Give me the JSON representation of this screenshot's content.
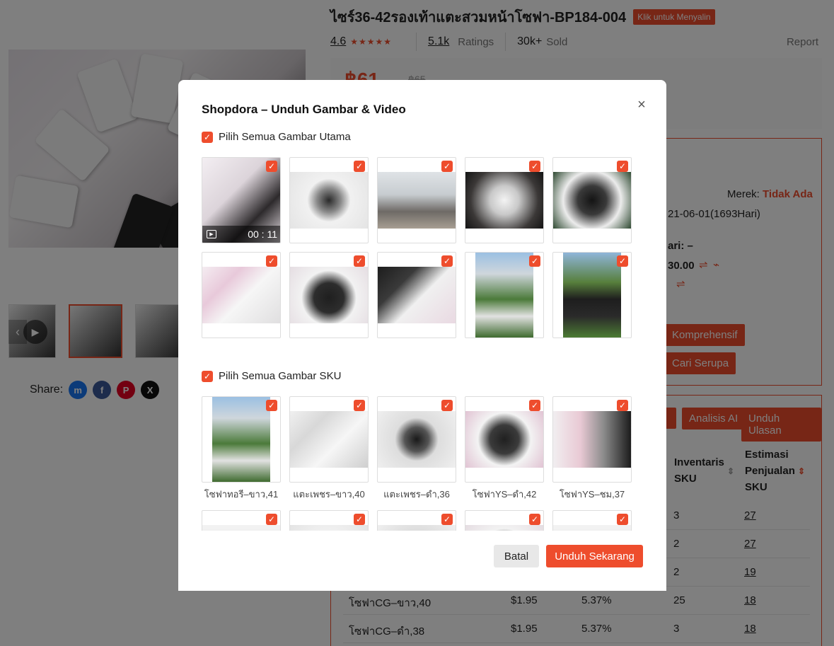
{
  "page": {
    "product_title": "ไซร์36-42รองเท้าแตะสวมหน้าโซฟา-BP184-004",
    "copy_badge": "Klik untuk Menyalin",
    "rating": "4.6",
    "ratings_count": "5.1k",
    "ratings_label": "Ratings",
    "sold_count": "30k+",
    "sold_label": "Sold",
    "report": "Report",
    "price": "฿61",
    "old_price": "฿65",
    "brand_label": "Merek:",
    "brand_value": "Tidak Ada",
    "date_text": "21-06-01(1693Hari)",
    "hari_text": "ari: –",
    "amount_text": "30.00",
    "btn_komprehensif": "Komprehensif",
    "btn_cari_serupa": "Cari Serupa",
    "btn_analisis_ai": "Analisis AI",
    "btn_unduh_ulasan": "Unduh Ulasan",
    "share_label": "Share:",
    "col_inventaris": "Inventaris SKU",
    "col_estimasi": "Estimasi Penjualan SKU",
    "rows": [
      {
        "inventaris": "3",
        "estimasi": "27"
      },
      {
        "inventaris": "2",
        "estimasi": "27"
      },
      {
        "inventaris": "2",
        "estimasi": "19"
      },
      {
        "name": "โซฟาCG–ขาว,40",
        "price": "$1.95",
        "pct": "5.37%",
        "inventaris": "25",
        "estimasi": "18"
      },
      {
        "name": "โซฟาCG–ดำ,38",
        "price": "$1.95",
        "pct": "5.37%",
        "inventaris": "3",
        "estimasi": "18"
      }
    ]
  },
  "modal": {
    "title": "Shopdora – Unduh Gambar & Video",
    "close_icon": "close-icon",
    "main_section_label": "Pilih Semua Gambar Utama",
    "sku_section_label": "Pilih Semua Gambar SKU",
    "video_duration": "00 : 11",
    "sku_labels": [
      "โซฟาทอรี–ขาว,41",
      "แตะเพชร–ขาว,40",
      "แตะเพชร–ดำ,36",
      "โซฟาYS–ดำ,42",
      "โซฟาYS–ชม,37"
    ],
    "cancel": "Batal",
    "download": "Unduh Sekarang"
  },
  "colors": {
    "accent": "#ee4d2d",
    "overlay": "rgba(0,0,0,0.5)"
  }
}
